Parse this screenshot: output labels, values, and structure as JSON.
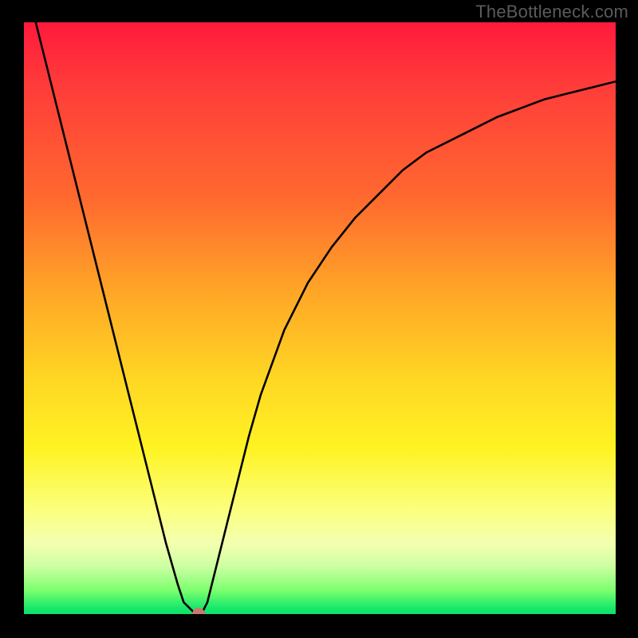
{
  "watermark": "TheBottleneck.com",
  "chart_data": {
    "type": "line",
    "title": "",
    "xlabel": "",
    "ylabel": "",
    "xlim": [
      0,
      100
    ],
    "ylim": [
      0,
      100
    ],
    "x": [
      0,
      2,
      4,
      6,
      8,
      10,
      12,
      14,
      16,
      18,
      20,
      22,
      24,
      26,
      27,
      28,
      29,
      30,
      31,
      32,
      34,
      36,
      38,
      40,
      44,
      48,
      52,
      56,
      60,
      64,
      68,
      72,
      76,
      80,
      84,
      88,
      92,
      96,
      100
    ],
    "y": [
      108,
      100,
      92,
      84,
      76,
      68,
      60,
      52,
      44,
      36,
      28,
      20,
      12,
      5,
      2,
      1,
      0,
      0,
      2,
      6,
      14,
      22,
      30,
      37,
      48,
      56,
      62,
      67,
      71,
      75,
      78,
      80,
      82,
      84,
      85.5,
      87,
      88,
      89,
      90
    ],
    "minimum_point": {
      "x": 29.5,
      "y": 0
    },
    "annotations": []
  },
  "colors": {
    "curve": "#000000",
    "dot": "#c9796e",
    "frame": "#000000"
  }
}
